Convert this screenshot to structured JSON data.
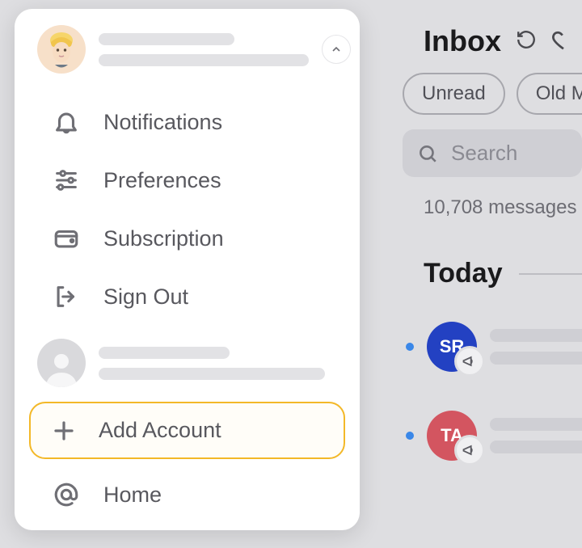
{
  "dropdown": {
    "menu": {
      "notifications": "Notifications",
      "preferences": "Preferences",
      "subscription": "Subscription",
      "sign_out": "Sign Out",
      "add_account": "Add Account",
      "home": "Home"
    }
  },
  "inbox": {
    "title": "Inbox",
    "filters": {
      "unread": "Unread",
      "old_mail": "Old Mail"
    },
    "search_placeholder": "Search",
    "message_count": "10,708 messages",
    "today_label": "Today",
    "items": [
      {
        "initials": "SR",
        "color": "blue"
      },
      {
        "initials": "TA",
        "color": "red"
      }
    ]
  }
}
